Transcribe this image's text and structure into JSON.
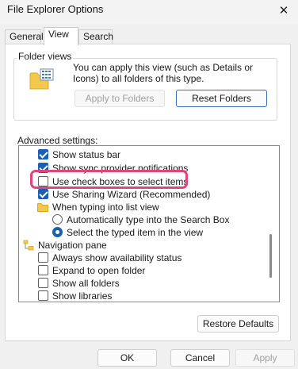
{
  "window": {
    "title": "File Explorer Options",
    "close_glyph": "✕"
  },
  "tabs": [
    {
      "label": "General",
      "active": false
    },
    {
      "label": "View",
      "active": true
    },
    {
      "label": "Search",
      "active": false
    }
  ],
  "folder_views": {
    "legend": "Folder views",
    "description": "You can apply this view (such as Details or Icons) to all folders of this type.",
    "apply_label": "Apply to Folders",
    "apply_enabled": false,
    "reset_label": "Reset Folders"
  },
  "advanced": {
    "label": "Advanced settings:",
    "items": [
      {
        "type": "checkbox",
        "checked": true,
        "label": "Show status bar"
      },
      {
        "type": "checkbox",
        "checked": true,
        "label": "Show sync provider notifications"
      },
      {
        "type": "checkbox",
        "checked": false,
        "label": "Use check boxes to select items",
        "highlighted": true
      },
      {
        "type": "checkbox",
        "checked": true,
        "label": "Use Sharing Wizard (Recommended)"
      },
      {
        "type": "folder",
        "icon": "folder-icon",
        "label": "When typing into list view"
      },
      {
        "type": "radio",
        "checked": false,
        "label": "Automatically type into the Search Box"
      },
      {
        "type": "radio",
        "checked": true,
        "label": "Select the typed item in the view"
      },
      {
        "type": "nav",
        "icon": "navigation-pane-icon",
        "label": "Navigation pane"
      },
      {
        "type": "checkbox",
        "checked": false,
        "label": "Always show availability status"
      },
      {
        "type": "checkbox",
        "checked": false,
        "label": "Expand to open folder"
      },
      {
        "type": "checkbox",
        "checked": false,
        "label": "Show all folders"
      },
      {
        "type": "checkbox",
        "checked": false,
        "label": "Show libraries"
      }
    ],
    "restore_label": "Restore Defaults"
  },
  "footer": {
    "ok_label": "OK",
    "cancel_label": "Cancel",
    "apply_label": "Apply",
    "apply_enabled": false
  },
  "colors": {
    "accent": "#1a5fb4",
    "highlight_ring": "#e0457b",
    "folder_yellow": "#f2c94c"
  }
}
